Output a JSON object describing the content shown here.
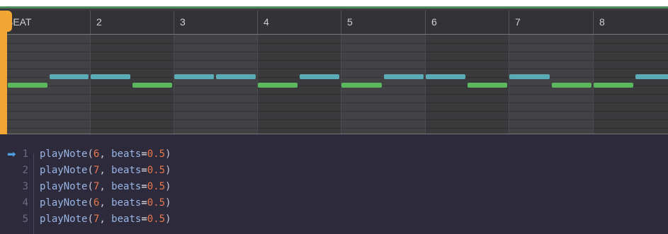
{
  "header": {
    "beats": [
      "BEAT",
      "2",
      "3",
      "4",
      "5",
      "6",
      "7",
      "8"
    ]
  },
  "piano_roll": {
    "colors": {
      "low_note": "#5cb85c",
      "high_note": "#5aaab8",
      "playhead": "#f2a633"
    },
    "notes": [
      {
        "pitch": 6,
        "beat": 1.0,
        "beats": 0.5
      },
      {
        "pitch": 7,
        "beat": 1.5,
        "beats": 0.5
      },
      {
        "pitch": 7,
        "beat": 2.0,
        "beats": 0.5
      },
      {
        "pitch": 6,
        "beat": 2.5,
        "beats": 0.5
      },
      {
        "pitch": 7,
        "beat": 3.0,
        "beats": 0.5
      },
      {
        "pitch": 7,
        "beat": 3.5,
        "beats": 0.5
      },
      {
        "pitch": 6,
        "beat": 4.0,
        "beats": 0.5
      },
      {
        "pitch": 7,
        "beat": 4.5,
        "beats": 0.5
      },
      {
        "pitch": 6,
        "beat": 5.0,
        "beats": 0.5
      },
      {
        "pitch": 7,
        "beat": 5.5,
        "beats": 0.5
      },
      {
        "pitch": 7,
        "beat": 6.0,
        "beats": 0.5
      },
      {
        "pitch": 6,
        "beat": 6.5,
        "beats": 0.5
      },
      {
        "pitch": 7,
        "beat": 7.0,
        "beats": 0.5
      },
      {
        "pitch": 6,
        "beat": 7.5,
        "beats": 0.5
      },
      {
        "pitch": 6,
        "beat": 8.0,
        "beats": 0.5
      },
      {
        "pitch": 7,
        "beat": 8.5,
        "beats": 0.5
      }
    ]
  },
  "editor": {
    "current_line": 1,
    "lines": [
      {
        "num": "1",
        "fn": "playNote",
        "open": "(",
        "pitch": "6",
        "sep": ", ",
        "kw": "beats",
        "eq": "=",
        "val": "0.5",
        "close": ")"
      },
      {
        "num": "2",
        "fn": "playNote",
        "open": "(",
        "pitch": "7",
        "sep": ", ",
        "kw": "beats",
        "eq": "=",
        "val": "0.5",
        "close": ")"
      },
      {
        "num": "3",
        "fn": "playNote",
        "open": "(",
        "pitch": "7",
        "sep": ", ",
        "kw": "beats",
        "eq": "=",
        "val": "0.5",
        "close": ")"
      },
      {
        "num": "4",
        "fn": "playNote",
        "open": "(",
        "pitch": "6",
        "sep": ", ",
        "kw": "beats",
        "eq": "=",
        "val": "0.5",
        "close": ")"
      },
      {
        "num": "5",
        "fn": "playNote",
        "open": "(",
        "pitch": "7",
        "sep": ", ",
        "kw": "beats",
        "eq": "=",
        "val": "0.5",
        "close": ")"
      }
    ]
  }
}
